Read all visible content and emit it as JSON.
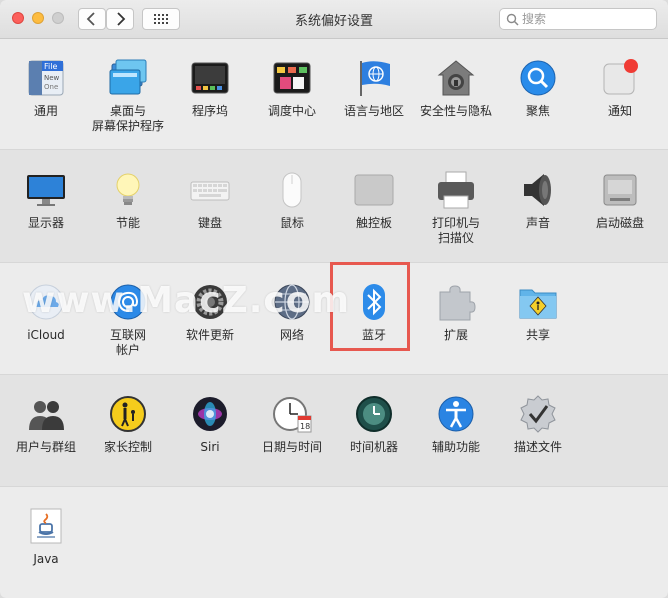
{
  "window": {
    "title": "系统偏好设置"
  },
  "search": {
    "placeholder": "搜索"
  },
  "watermark": "www.MacZ.com",
  "rows": [
    [
      {
        "label": "通用",
        "icon": "general-icon"
      },
      {
        "label": "桌面与\n屏幕保护程序",
        "icon": "desktop-screensaver-icon"
      },
      {
        "label": "程序坞",
        "icon": "dock-icon"
      },
      {
        "label": "调度中心",
        "icon": "mission-control-icon"
      },
      {
        "label": "语言与地区",
        "icon": "language-region-icon"
      },
      {
        "label": "安全性与隐私",
        "icon": "security-privacy-icon"
      },
      {
        "label": "聚焦",
        "icon": "spotlight-icon"
      },
      {
        "label": "通知",
        "icon": "notifications-icon"
      }
    ],
    [
      {
        "label": "显示器",
        "icon": "displays-icon"
      },
      {
        "label": "节能",
        "icon": "energy-saver-icon"
      },
      {
        "label": "键盘",
        "icon": "keyboard-icon"
      },
      {
        "label": "鼠标",
        "icon": "mouse-icon"
      },
      {
        "label": "触控板",
        "icon": "trackpad-icon"
      },
      {
        "label": "打印机与\n扫描仪",
        "icon": "printers-scanners-icon"
      },
      {
        "label": "声音",
        "icon": "sound-icon"
      },
      {
        "label": "启动磁盘",
        "icon": "startup-disk-icon"
      }
    ],
    [
      {
        "label": "iCloud",
        "icon": "icloud-icon"
      },
      {
        "label": "互联网\n帐户",
        "icon": "internet-accounts-icon"
      },
      {
        "label": "软件更新",
        "icon": "software-update-icon"
      },
      {
        "label": "网络",
        "icon": "network-icon"
      },
      {
        "label": "蓝牙",
        "icon": "bluetooth-icon"
      },
      {
        "label": "扩展",
        "icon": "extensions-icon"
      },
      {
        "label": "共享",
        "icon": "sharing-icon"
      }
    ],
    [
      {
        "label": "用户与群组",
        "icon": "users-groups-icon"
      },
      {
        "label": "家长控制",
        "icon": "parental-controls-icon"
      },
      {
        "label": "Siri",
        "icon": "siri-icon"
      },
      {
        "label": "日期与时间",
        "icon": "date-time-icon"
      },
      {
        "label": "时间机器",
        "icon": "time-machine-icon"
      },
      {
        "label": "辅助功能",
        "icon": "accessibility-icon"
      },
      {
        "label": "描述文件",
        "icon": "profiles-icon"
      }
    ],
    [
      {
        "label": "Java",
        "icon": "java-icon"
      }
    ]
  ],
  "icon_text": {
    "general": [
      "File",
      "New",
      "One"
    ],
    "date_day": "18"
  },
  "colors": {
    "highlight": "#e7584f",
    "close": "#fc605c",
    "minimize": "#fdbc40",
    "zoom": "#cfcfcf"
  }
}
